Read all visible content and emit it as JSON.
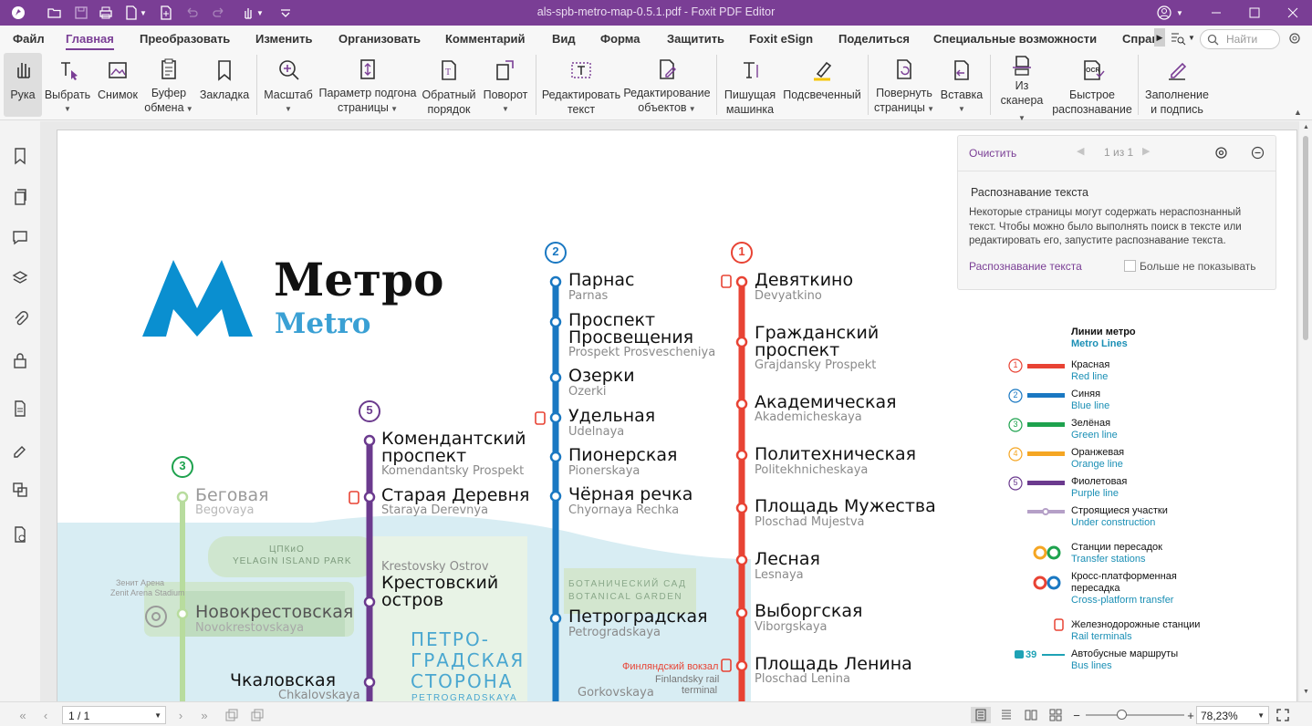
{
  "window": {
    "title": "als-spb-metro-map-0.5.1.pdf - Foxit PDF Editor"
  },
  "menu": {
    "tabs": [
      "Файл",
      "Главная",
      "Преобразовать",
      "Изменить",
      "Организовать",
      "Комментарий",
      "Вид",
      "Форма",
      "Защитить",
      "Foxit eSign",
      "Поделиться",
      "Специальные возможности",
      "Справ"
    ],
    "active": "Главная",
    "search_placeholder": "Найти"
  },
  "ribbon": {
    "hand": "Рука",
    "select": "Выбрать",
    "snapshot": "Снимок",
    "clipboard_1": "Буфер",
    "clipboard_2": "обмена",
    "bookmark": "Закладка",
    "zoom": "Масштаб",
    "fit_1": "Параметр подгона",
    "fit_2": "страницы",
    "reverse_1": "Обратный",
    "reverse_2": "порядок",
    "rotate": "Поворот",
    "edit_text_1": "Редактировать",
    "edit_text_2": "текст",
    "edit_obj_1": "Редактирование",
    "edit_obj_2": "объектов",
    "typewriter_1": "Пишущая",
    "typewriter_2": "машинка",
    "highlight": "Подсвеченный",
    "rotate_pages_1": "Повернуть",
    "rotate_pages_2": "страницы",
    "insert": "Вставка",
    "scanner_1": "Из",
    "scanner_2": "сканера",
    "ocr_1": "Быстрое",
    "ocr_2": "распознавание",
    "fill_sign_1": "Заполнение",
    "fill_sign_2": "и подпись"
  },
  "ocr_panel": {
    "clear": "Очистить",
    "pages": "1 из 1",
    "title": "Распознавание текста",
    "text_1": "Некоторые страницы могут содержать нераспознанный",
    "text_2": "текст. Чтобы можно было выполнять поиск в тексте или",
    "text_3": "редактировать его, запустите распознавание текста.",
    "link": "Распознавание текста",
    "checkbox": "Больше не показывать"
  },
  "map": {
    "logo_ru": "Метро",
    "logo_en": "Metro",
    "line1_stations": [
      {
        "ru": "Девяткино",
        "en": "Devyatkino"
      },
      {
        "ru": "Гражданский",
        "ru2": "проспект",
        "en": "Grajdansky Prospekt"
      },
      {
        "ru": "Академическая",
        "en": "Akademicheskaya"
      },
      {
        "ru": "Политехническая",
        "en": "Politekhnicheskaya"
      },
      {
        "ru": "Площадь Мужества",
        "en": "Ploschad Mujestva"
      },
      {
        "ru": "Лесная",
        "en": "Lesnaya"
      },
      {
        "ru": "Выборгская",
        "en": "Viborgskaya"
      },
      {
        "ru": "Площадь Ленина",
        "en": "Ploschad Lenina"
      }
    ],
    "line2_stations": [
      {
        "ru": "Парнас",
        "en": "Parnas"
      },
      {
        "ru": "Проспект",
        "ru2": "Просвещения",
        "en": "Prospekt Prosvescheniya"
      },
      {
        "ru": "Озерки",
        "en": "Ozerki"
      },
      {
        "ru": "Удельная",
        "en": "Udelnaya"
      },
      {
        "ru": "Пионерская",
        "en": "Pionerskaya"
      },
      {
        "ru": "Чёрная речка",
        "en": "Chyornaya Rechka"
      },
      {
        "ru": "Петроградская",
        "en": "Petrogradskaya"
      }
    ],
    "line2_partial": "Gorkovskaya",
    "line5_stations": [
      {
        "ru": "Комендантский",
        "ru2": "проспект",
        "en": "Komendantsky Prospekt"
      },
      {
        "ru": "Старая Деревня",
        "en": "Staraya Derevnya"
      },
      {
        "ru": "Крестовский",
        "ru2": "остров",
        "en": "Krestovsky Ostrov"
      },
      {
        "ru": "Чкаловская",
        "en": "Chkalovskaya"
      }
    ],
    "line3_stations": [
      {
        "ru": "Беговая",
        "en": "Begovaya"
      },
      {
        "ru": "Новокрестовская",
        "en": "Novokrestovskaya"
      }
    ],
    "line_numbers": [
      "1",
      "2",
      "3",
      "5"
    ],
    "park_ru": "ЦПКиО",
    "park_en": "YELAGIN ISLAND PARK",
    "garden_ru": "БОТАНИЧЕСКИЙ САД",
    "garden_en": "BOTANICAL GARDEN",
    "stadium_ru": "Зенит Арена",
    "stadium_en": "Zenit Arena Stadium",
    "district_1": "ПЕТРО-",
    "district_2": "ГРАДСКАЯ",
    "district_3": "СТОРОНА",
    "district_en": "PETROGRADSKAYA",
    "finland_ru": "Финляндский вокзал",
    "finland_en_1": "Finlandsky rail",
    "finland_en_2": "terminal"
  },
  "legend": {
    "title_ru": "Линии метро",
    "title_en": "Metro Lines",
    "items": [
      {
        "num": "1",
        "ru": "Красная",
        "en": "Red line",
        "color": "#e84334"
      },
      {
        "num": "2",
        "ru": "Синяя",
        "en": "Blue line",
        "color": "#1a78c2"
      },
      {
        "num": "3",
        "ru": "Зелёная",
        "en": "Green line",
        "color": "#1ea24e"
      },
      {
        "num": "4",
        "ru": "Оранжевая",
        "en": "Orange line",
        "color": "#f5a623"
      },
      {
        "num": "5",
        "ru": "Фиолетовая",
        "en": "Purple line",
        "color": "#6b3a8e"
      }
    ],
    "construction_ru": "Строящиеся участки",
    "construction_en": "Under construction",
    "transfer_ru": "Станции пересадок",
    "transfer_en": "Transfer stations",
    "cross_ru_1": "Кросс-платформенная",
    "cross_ru_2": "пересадка",
    "cross_en": "Cross-platform transfer",
    "rail_ru": "Железнодорожные станции",
    "rail_en": "Rail terminals",
    "bus_num": "39",
    "bus_ru": "Автобусные маршруты",
    "bus_en": "Bus lines"
  },
  "status": {
    "page": "1 / 1",
    "zoom": "78,23%"
  },
  "colors": {
    "accent": "#7a3e95",
    "red": "#e84334",
    "blue": "#1a78c2",
    "green": "#a9d28a",
    "purple": "#6b3a8e",
    "logo": "#0a8fd0"
  }
}
